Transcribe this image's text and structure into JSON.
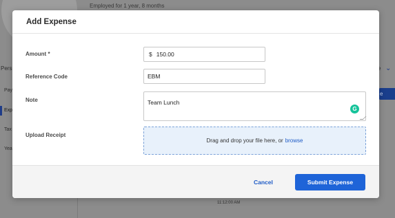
{
  "background": {
    "employed_text": "Employed for 1 year, 8 months",
    "section_label": "Pers",
    "sidebar_items": [
      "Pay",
      "Exp",
      "Tax",
      "Yea"
    ],
    "right_label": "e",
    "right_button": "e",
    "timestamp": "11:12:00 AM"
  },
  "modal": {
    "title": "Add Expense",
    "amount": {
      "label": "Amount *",
      "currency": "$",
      "value": "150.00"
    },
    "reference_code": {
      "label": "Reference Code",
      "value": "EBM"
    },
    "note": {
      "label": "Note",
      "value": "Team Lunch"
    },
    "upload_receipt": {
      "label": "Upload Receipt",
      "instruction": "Drag and drop your file here, or",
      "browse_link": "browse"
    },
    "footer": {
      "cancel_label": "Cancel",
      "submit_label": "Submit Expense"
    }
  },
  "colors": {
    "primary": "#1e64d8",
    "link": "#1e5bc6",
    "dropzone_bg": "#e8f1fb",
    "grammarly": "#15c39a"
  },
  "icons": {
    "grammarly": "grammarly-icon",
    "chevron": "chevron-down-icon"
  }
}
